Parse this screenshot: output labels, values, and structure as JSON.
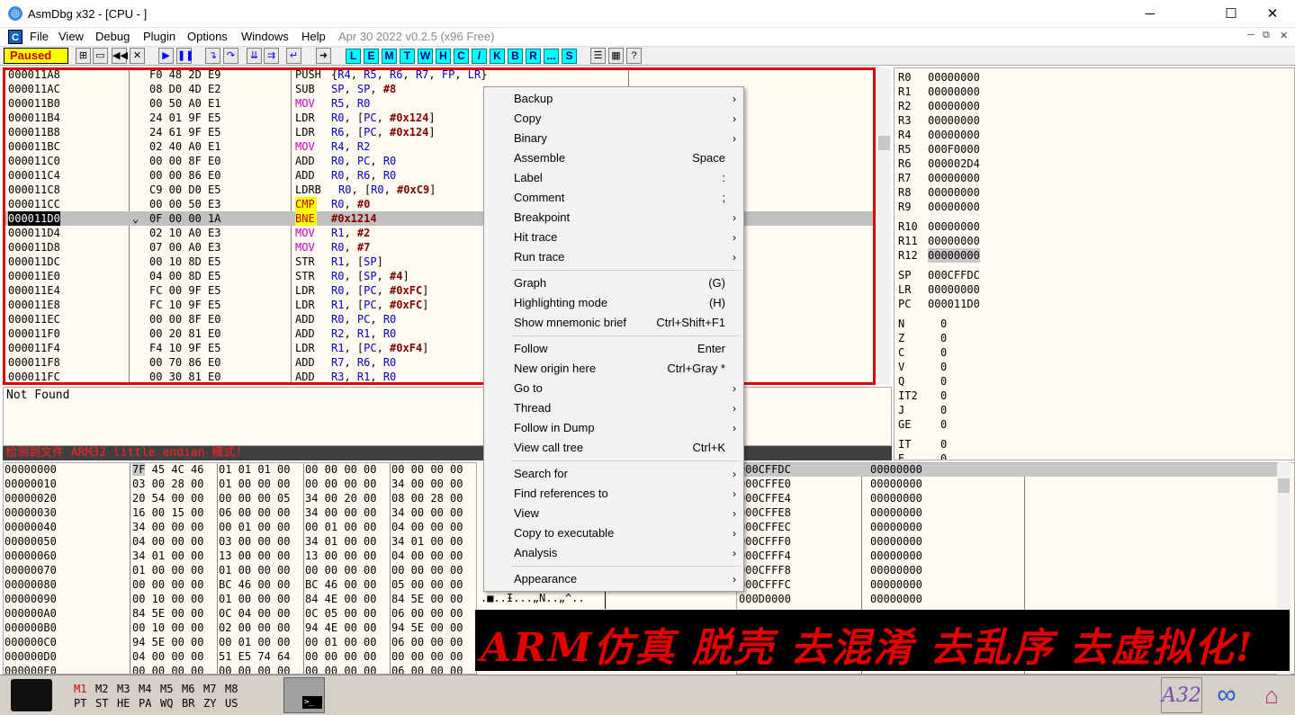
{
  "title": "AsmDbg x32 - [CPU - ]",
  "menu": {
    "file": "File",
    "view": "View",
    "debug": "Debug",
    "plugin": "Plugin",
    "options": "Options",
    "windows": "Windows",
    "help": "Help",
    "version": "Apr 30 2022  v0.2.5 (x96 Free)"
  },
  "toolbar": {
    "status": "Paused",
    "letters": [
      "L",
      "E",
      "M",
      "T",
      "W",
      "H",
      "C",
      "/",
      "K",
      "B",
      "R",
      "...",
      "S"
    ]
  },
  "cpu_rows": [
    {
      "addr": "000011A8",
      "hex": "F0 48 2D E9",
      "mn": "PUSH",
      "ops": "{R4, R5, R6, R7, FP, LR}"
    },
    {
      "addr": "000011AC",
      "hex": "08 D0 4D E2",
      "mn": "SUB",
      "ops": "SP, SP, #8"
    },
    {
      "addr": "000011B0",
      "hex": "00 50 A0 E1",
      "mn": "MOV",
      "ops": "R5, R0"
    },
    {
      "addr": "000011B4",
      "hex": "24 01 9F E5",
      "mn": "LDR",
      "ops": "R0, [PC, #0x124]"
    },
    {
      "addr": "000011B8",
      "hex": "24 61 9F E5",
      "mn": "LDR",
      "ops": "R6, [PC, #0x124]"
    },
    {
      "addr": "000011BC",
      "hex": "02 40 A0 E1",
      "mn": "MOV",
      "ops": "R4, R2"
    },
    {
      "addr": "000011C0",
      "hex": "00 00 8F E0",
      "mn": "ADD",
      "ops": "R0, PC, R0"
    },
    {
      "addr": "000011C4",
      "hex": "00 00 86 E0",
      "mn": "ADD",
      "ops": "R0, R6, R0"
    },
    {
      "addr": "000011C8",
      "hex": "C9 00 D0 E5",
      "mn": "LDRB",
      "ops": "R0, [R0, #0xC9]"
    },
    {
      "addr": "000011CC",
      "hex": "00 00 50 E3",
      "mn": "CMP",
      "ops": "R0, #0"
    },
    {
      "addr": "000011D0",
      "hex": "0F 00 00 1A",
      "mn": "BNE",
      "ops": "#0x1214"
    },
    {
      "addr": "000011D4",
      "hex": "02 10 A0 E3",
      "mn": "MOV",
      "ops": "R1, #2"
    },
    {
      "addr": "000011D8",
      "hex": "07 00 A0 E3",
      "mn": "MOV",
      "ops": "R0, #7"
    },
    {
      "addr": "000011DC",
      "hex": "00 10 8D E5",
      "mn": "STR",
      "ops": "R1, [SP]"
    },
    {
      "addr": "000011E0",
      "hex": "04 00 8D E5",
      "mn": "STR",
      "ops": "R0, [SP, #4]"
    },
    {
      "addr": "000011E4",
      "hex": "FC 00 9F E5",
      "mn": "LDR",
      "ops": "R0, [PC, #0xFC]"
    },
    {
      "addr": "000011E8",
      "hex": "FC 10 9F E5",
      "mn": "LDR",
      "ops": "R1, [PC, #0xFC]"
    },
    {
      "addr": "000011EC",
      "hex": "00 00 8F E0",
      "mn": "ADD",
      "ops": "R0, PC, R0"
    },
    {
      "addr": "000011F0",
      "hex": "00 20 81 E0",
      "mn": "ADD",
      "ops": "R2, R1, R0"
    },
    {
      "addr": "000011F4",
      "hex": "F4 10 9F E5",
      "mn": "LDR",
      "ops": "R1, [PC, #0xF4]"
    },
    {
      "addr": "000011F8",
      "hex": "00 70 86 E0",
      "mn": "ADD",
      "ops": "R7, R6, R0"
    },
    {
      "addr": "000011FC",
      "hex": "00 30 81 E0",
      "mn": "ADD",
      "ops": "R3, R1, R0"
    }
  ],
  "info_text": "Not Found",
  "log_text": "检测到文件 ARM32 little endian 模式!",
  "registers": [
    {
      "n": "R0",
      "v": "00000000"
    },
    {
      "n": "R1",
      "v": "00000000"
    },
    {
      "n": "R2",
      "v": "00000000"
    },
    {
      "n": "R3",
      "v": "00000000"
    },
    {
      "n": "R4",
      "v": "00000000"
    },
    {
      "n": "R5",
      "v": "000F0000"
    },
    {
      "n": "R6",
      "v": "000002D4"
    },
    {
      "n": "R7",
      "v": "00000000"
    },
    {
      "n": "R8",
      "v": "00000000"
    },
    {
      "n": "R9",
      "v": "00000000"
    },
    {
      "n": "R10",
      "v": "00000000"
    },
    {
      "n": "R11",
      "v": "00000000"
    },
    {
      "n": "R12",
      "v": "00000000"
    },
    {
      "n": "SP",
      "v": "000CFFDC"
    },
    {
      "n": "LR",
      "v": "00000000"
    },
    {
      "n": "PC",
      "v": "000011D0"
    }
  ],
  "flags": [
    {
      "n": "N",
      "v": "0"
    },
    {
      "n": "Z",
      "v": "0"
    },
    {
      "n": "C",
      "v": "0"
    },
    {
      "n": "V",
      "v": "0"
    },
    {
      "n": "Q",
      "v": "0"
    },
    {
      "n": "IT2",
      "v": "0"
    },
    {
      "n": "J",
      "v": "0"
    },
    {
      "n": "GE",
      "v": "0"
    },
    {
      "n": "IT",
      "v": "0"
    },
    {
      "n": "E",
      "v": "0"
    }
  ],
  "dump_rows": [
    {
      "addr": "00000000",
      "b": [
        "7F 45 4C 46",
        "01 01 01 00",
        "00 00 00 00",
        "00 00 00 00"
      ]
    },
    {
      "addr": "00000010",
      "b": [
        "03 00 28 00",
        "01 00 00 00",
        "00 00 00 00",
        "34 00 00 00"
      ]
    },
    {
      "addr": "00000020",
      "b": [
        "20 54 00 00",
        "00 00 00 05",
        "34 00 20 00",
        "08 00 28 00"
      ]
    },
    {
      "addr": "00000030",
      "b": [
        "16 00 15 00",
        "06 00 00 00",
        "34 00 00 00",
        "34 00 00 00"
      ]
    },
    {
      "addr": "00000040",
      "b": [
        "34 00 00 00",
        "00 01 00 00",
        "00 01 00 00",
        "04 00 00 00"
      ]
    },
    {
      "addr": "00000050",
      "b": [
        "04 00 00 00",
        "03 00 00 00",
        "34 01 00 00",
        "34 01 00 00"
      ]
    },
    {
      "addr": "00000060",
      "b": [
        "34 01 00 00",
        "13 00 00 00",
        "13 00 00 00",
        "04 00 00 00"
      ]
    },
    {
      "addr": "00000070",
      "b": [
        "01 00 00 00",
        "01 00 00 00",
        "00 00 00 00",
        "00 00 00 00"
      ]
    },
    {
      "addr": "00000080",
      "b": [
        "00 00 00 00",
        "BC 46 00 00",
        "BC 46 00 00",
        "05 00 00 00"
      ]
    },
    {
      "addr": "00000090",
      "b": [
        "00 10 00 00",
        "01 00 00 00",
        "84 4E 00 00",
        "84 5E 00 00"
      ]
    },
    {
      "addr": "000000A0",
      "b": [
        "84 5E 00 00",
        "0C 04 00 00",
        "0C 05 00 00",
        "06 00 00 00"
      ]
    },
    {
      "addr": "000000B0",
      "b": [
        "00 10 00 00",
        "02 00 00 00",
        "94 4E 00 00",
        "94 5E 00 00"
      ]
    },
    {
      "addr": "000000C0",
      "b": [
        "94 5E 00 00",
        "00 01 00 00",
        "00 01 00 00",
        "06 00 00 00"
      ]
    },
    {
      "addr": "000000D0",
      "b": [
        "04 00 00 00",
        "51 E5 74 64",
        "00 00 00 00",
        "00 00 00 00"
      ]
    },
    {
      "addr": "000000E0",
      "b": [
        "00 00 00 00",
        "00 00 00 00",
        "00 00 00 00",
        "06 00 00 00"
      ]
    }
  ],
  "ascii_line": ".■..Ɨ...„N..„^..",
  "stack_rows": [
    {
      "a": "000CFFDC",
      "v": "00000000"
    },
    {
      "a": "000CFFE0",
      "v": "00000000"
    },
    {
      "a": "000CFFE4",
      "v": "00000000"
    },
    {
      "a": "000CFFE8",
      "v": "00000000"
    },
    {
      "a": "000CFFEC",
      "v": "00000000"
    },
    {
      "a": "000CFFF0",
      "v": "00000000"
    },
    {
      "a": "000CFFF4",
      "v": "00000000"
    },
    {
      "a": "000CFFF8",
      "v": "00000000"
    },
    {
      "a": "000CFFFC",
      "v": "00000000"
    },
    {
      "a": "000D0000",
      "v": "00000000"
    }
  ],
  "banner_text": "ARM仿真 脱壳 去混淆 去乱序 去虚拟化!",
  "bottom": {
    "m_row": [
      "M1",
      "M2",
      "M3",
      "M4",
      "M5",
      "M6",
      "M7",
      "M8"
    ],
    "s_row": [
      "PT",
      "ST",
      "HE",
      "PA",
      "WQ",
      "BR",
      "ZY",
      "US"
    ],
    "logo_label": "A32"
  },
  "context_menu": [
    {
      "label": "Backup",
      "shortcut": "",
      "arrow": true
    },
    {
      "label": "Copy",
      "shortcut": "",
      "arrow": true
    },
    {
      "label": "Binary",
      "shortcut": "",
      "arrow": true
    },
    {
      "label": "Assemble",
      "shortcut": "Space",
      "arrow": false
    },
    {
      "label": "Label",
      "shortcut": ":",
      "arrow": false
    },
    {
      "label": "Comment",
      "shortcut": ";",
      "arrow": false
    },
    {
      "label": "Breakpoint",
      "shortcut": "",
      "arrow": true
    },
    {
      "label": "Hit trace",
      "shortcut": "",
      "arrow": true
    },
    {
      "label": "Run trace",
      "shortcut": "",
      "arrow": true
    },
    {
      "sep": true
    },
    {
      "label": "Graph",
      "shortcut": "(G)",
      "arrow": false
    },
    {
      "label": "Highlighting mode",
      "shortcut": "(H)",
      "arrow": false
    },
    {
      "label": "Show mnemonic brief",
      "shortcut": "Ctrl+Shift+F1",
      "arrow": false
    },
    {
      "sep": true
    },
    {
      "label": "Follow",
      "shortcut": "Enter",
      "arrow": false
    },
    {
      "label": "New origin here",
      "shortcut": "Ctrl+Gray *",
      "arrow": false
    },
    {
      "label": "Go to",
      "shortcut": "",
      "arrow": true
    },
    {
      "label": "Thread",
      "shortcut": "",
      "arrow": true
    },
    {
      "label": "Follow in Dump",
      "shortcut": "",
      "arrow": true
    },
    {
      "label": "View call tree",
      "shortcut": "Ctrl+K",
      "arrow": false
    },
    {
      "sep": true
    },
    {
      "label": "Search for",
      "shortcut": "",
      "arrow": true
    },
    {
      "label": "Find references to",
      "shortcut": "",
      "arrow": true
    },
    {
      "label": "View",
      "shortcut": "",
      "arrow": true
    },
    {
      "label": "Copy to executable",
      "shortcut": "",
      "arrow": true
    },
    {
      "label": "Analysis",
      "shortcut": "",
      "arrow": true
    },
    {
      "sep": true
    },
    {
      "label": "Appearance",
      "shortcut": "",
      "arrow": true
    }
  ],
  "colors": {
    "selection": "#c0c0c0",
    "accent_red": "#e00000",
    "mnemonic_red": "#c00000",
    "operand_blue": "#0000c0",
    "immediate_maroon": "#800000",
    "panel_bg": "#fffbf0"
  }
}
